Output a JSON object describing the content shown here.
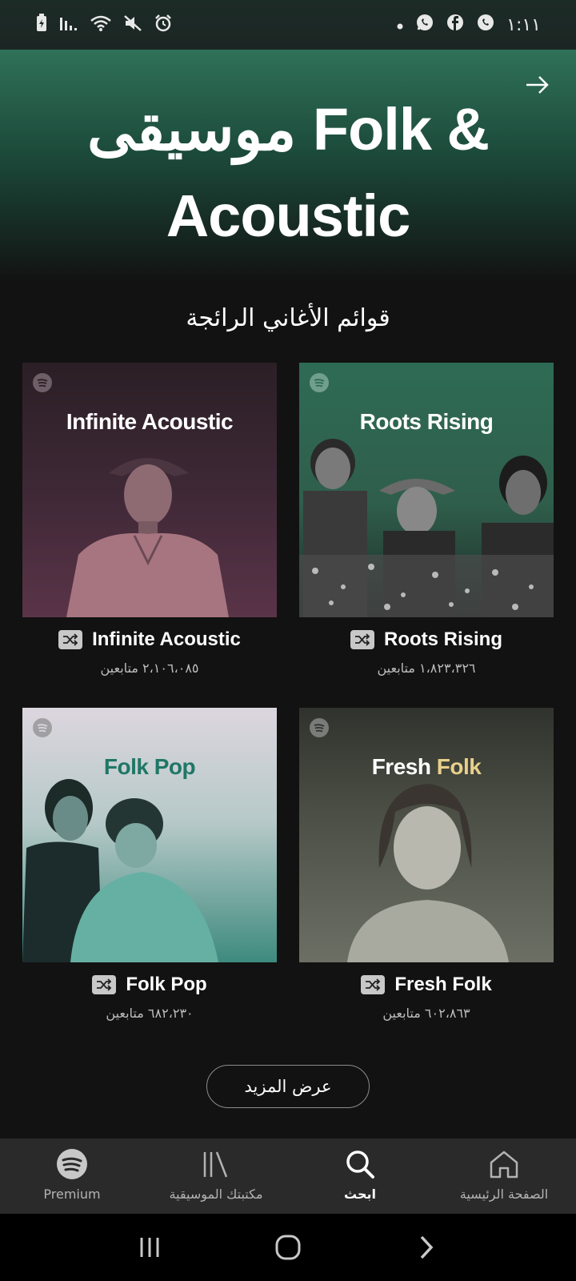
{
  "status": {
    "time": "١:١١"
  },
  "hero": {
    "title": "موسيقى Folk & Acoustic"
  },
  "section": {
    "title": "قوائم الأغاني الرائجة"
  },
  "playlists": [
    {
      "cover_text": "Infinite Acoustic",
      "name": "Infinite Acoustic",
      "followers": "٢،١٠٦،٠٨٥ متابعين",
      "cover_color": "#4a2a3a"
    },
    {
      "cover_text": "Roots Rising",
      "name": "Roots Rising",
      "followers": "١،٨٢٣،٣٢٦ متابعين",
      "cover_color": "#2e6b55"
    },
    {
      "cover_text": "Folk Pop",
      "name": "Folk Pop",
      "followers": "٦٨٢،٢٣٠ متابعين",
      "cover_color": "#3e8a7e"
    },
    {
      "cover_text": "Fresh Folk",
      "cover_text_accent": "Folk",
      "cover_text_main": "Fresh",
      "name": "Fresh Folk",
      "followers": "٦٠٢،٨٦٣ متابعين",
      "cover_color": "#5a5e52"
    }
  ],
  "more_button": "عرض المزيد",
  "tabs": [
    {
      "label": "Premium",
      "icon": "spotify-logo-icon"
    },
    {
      "label": "مكتبتك الموسيقية",
      "icon": "library-icon"
    },
    {
      "label": "ابحث",
      "icon": "search-icon"
    },
    {
      "label": "الصفحة الرئيسية",
      "icon": "home-icon"
    }
  ],
  "colors": {
    "background": "#121212",
    "hero_green": "#2f7159",
    "tabbar": "#2a2a2a"
  }
}
